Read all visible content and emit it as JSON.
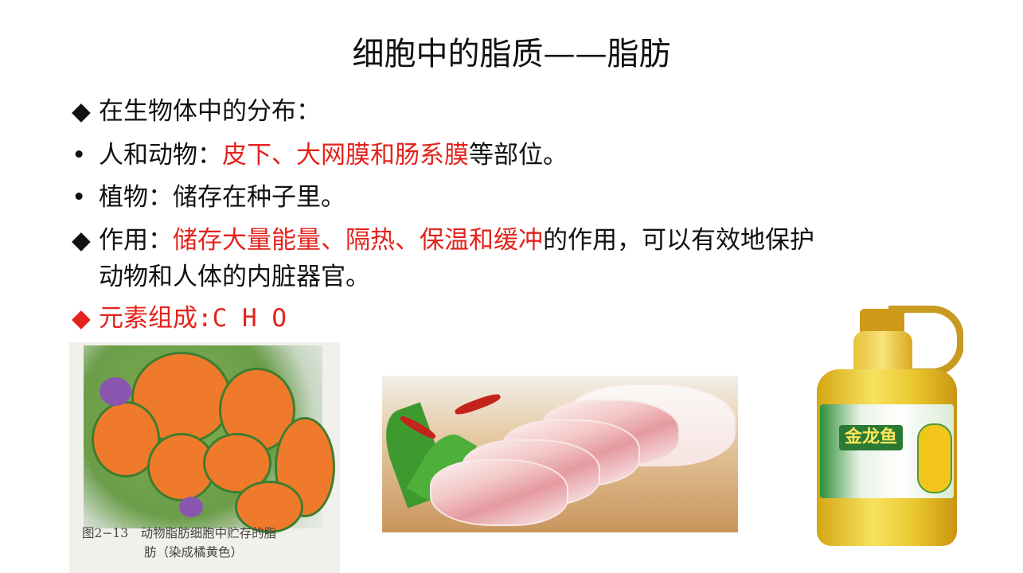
{
  "title": "细胞中的脂质——脂肪",
  "bullets": {
    "distribution_heading": "在生物体中的分布：",
    "animals_label": "人和动物：",
    "animals_highlight": "皮下、大网膜和肠系膜",
    "animals_suffix": "等部位。",
    "plants": "植物：储存在种子里。",
    "function_label": "作用：",
    "function_highlight": "储存大量能量、隔热、保温和缓冲",
    "function_suffix": "的作用，可以有效地保护",
    "function_line2": "动物和人体的内脏器官。",
    "elements": "元素组成:C H O"
  },
  "markers": {
    "diamond": "◆",
    "dot": "•"
  },
  "figure": {
    "caption_line1": "图2−13　动物脂肪细胞中贮存的脂",
    "caption_line2": "肪（染成橘黄色）"
  },
  "bottle_logo": "金龙鱼",
  "colors": {
    "highlight": "#e3231c",
    "text": "#111111"
  }
}
